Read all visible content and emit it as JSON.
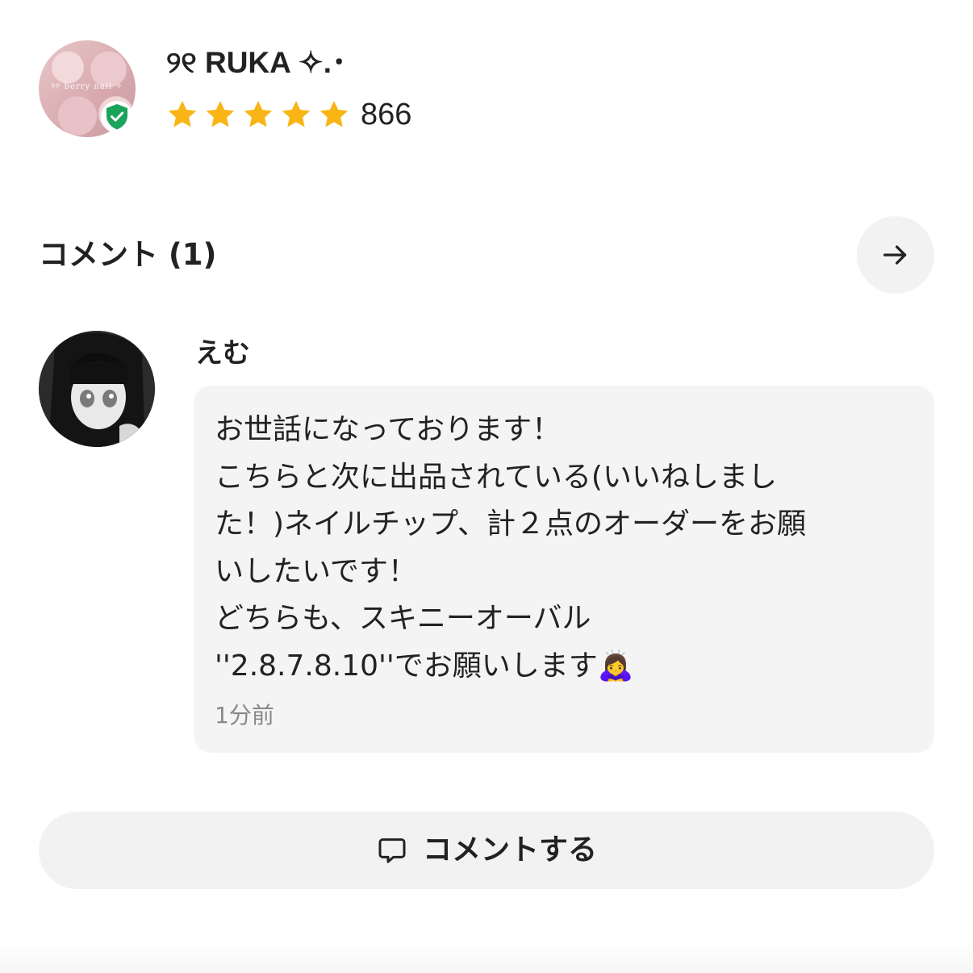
{
  "seller": {
    "name": "୨୧ RUKA  ✧.･",
    "avatar_text": "୨୧  berry  nail  ✧",
    "rating_stars": 5,
    "rating_count": "866",
    "verified": true,
    "star_color": "#f9b515",
    "badge_color": "#1aa35a"
  },
  "comments_section": {
    "title": "コメント (1)",
    "arrow_icon": "arrow-right-icon"
  },
  "comments": [
    {
      "author": "えむ",
      "lines": [
        "お世話になっております！",
        "こちらと次に出品されている(いいねしまし",
        "た！)ネイルチップ、計２点のオーダーをお願",
        "いしたいです！",
        "どちらも、スキニーオーバル",
        "''2.8.7.8.10''でお願いします🙇‍♀️"
      ],
      "time": "1分前"
    }
  ],
  "comment_button": {
    "label": "コメントする",
    "icon": "speech-bubble-icon"
  }
}
